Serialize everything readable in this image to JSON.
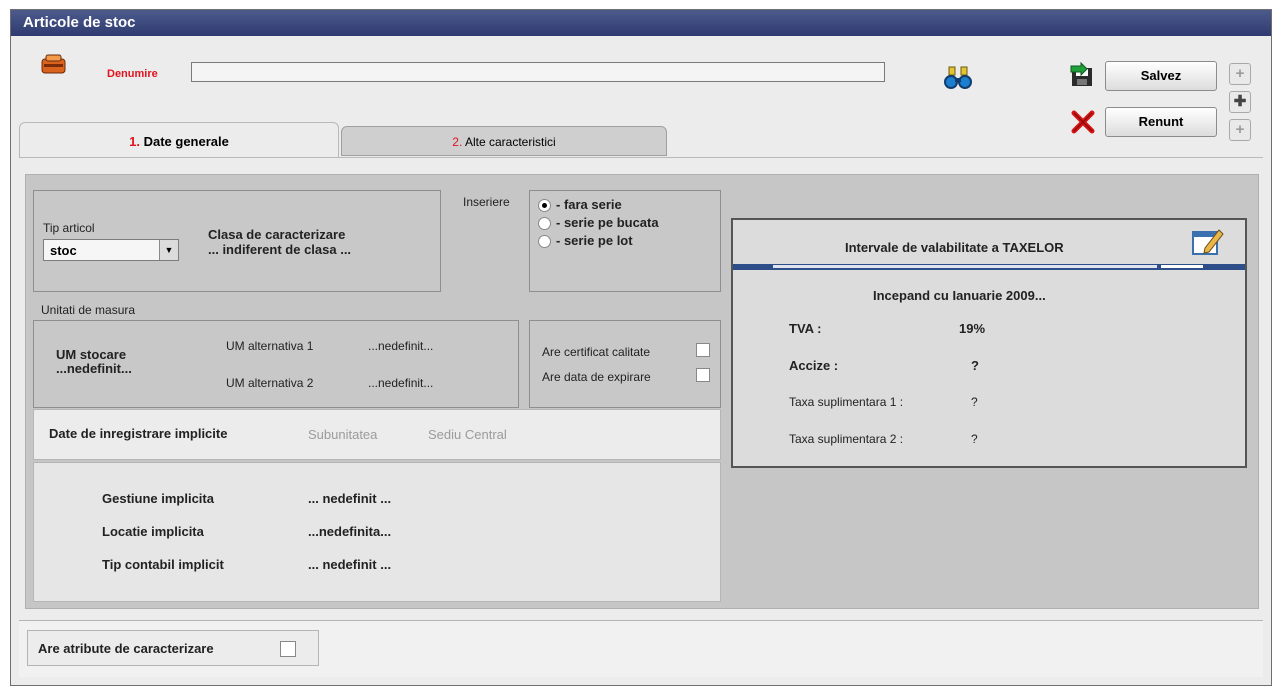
{
  "window": {
    "title": "Articole de stoc"
  },
  "header": {
    "denumire_label": "Denumire",
    "denumire_value": "",
    "save_label": "Salvez",
    "cancel_label": "Renunt",
    "icons": [
      "article-icon",
      "binoculars-icon",
      "save-icon",
      "cancel-x-icon",
      "up-icon",
      "plus-icon",
      "down-icon"
    ]
  },
  "tabs": [
    {
      "num": "1.",
      "label": "Date generale",
      "active": true
    },
    {
      "num": "2.",
      "label": "Alte caracteristici",
      "active": false
    }
  ],
  "tip_articol": {
    "label": "Tip articol",
    "value": "stoc"
  },
  "clasa": {
    "title": "Clasa de caracterizare",
    "value": "... indiferent de clasa ..."
  },
  "inseriere": {
    "label": "Inseriere",
    "options": [
      "- fara serie",
      "- serie pe bucata",
      "- serie pe lot"
    ],
    "selected": 0
  },
  "um": {
    "section_label": "Unitati de masura",
    "stocare_title": "UM stocare",
    "stocare_value": "...nedefinit...",
    "alt1_label": "UM alternativa 1",
    "alt1_value": "...nedefinit...",
    "alt2_label": "UM alternativa 2",
    "alt2_value": "...nedefinit..."
  },
  "certificat": {
    "cert_label": "Are certificat calitate",
    "expirare_label": "Are data de expirare"
  },
  "inregistrare": {
    "title": "Date de inregistrare implicite",
    "subunitate_label": "Subunitatea",
    "sediu_value": "Sediu Central",
    "rows": [
      {
        "label": "Gestiune implicita",
        "value": "... nedefinit ..."
      },
      {
        "label": "Locatie implicita",
        "value": "...nedefinita..."
      },
      {
        "label": "Tip contabil implicit",
        "value": "... nedefinit ..."
      }
    ]
  },
  "taxe": {
    "title": "Intervale de valabilitate a TAXELOR",
    "period": "Incepand cu Ianuarie 2009...",
    "tva_label": "TVA :",
    "tva_value": "19%",
    "accize_label": "Accize :",
    "accize_value": "?",
    "taxa1_label": "Taxa suplimentara 1 :",
    "taxa1_value": "?",
    "taxa2_label": "Taxa suplimentara 2 :",
    "taxa2_value": "?"
  },
  "atribute": {
    "label": "Are atribute de caracterizare"
  },
  "colors": {
    "accent": "#e0141e",
    "titlebar": "#3a4680",
    "tax_header_line": "#2e4e8a"
  }
}
